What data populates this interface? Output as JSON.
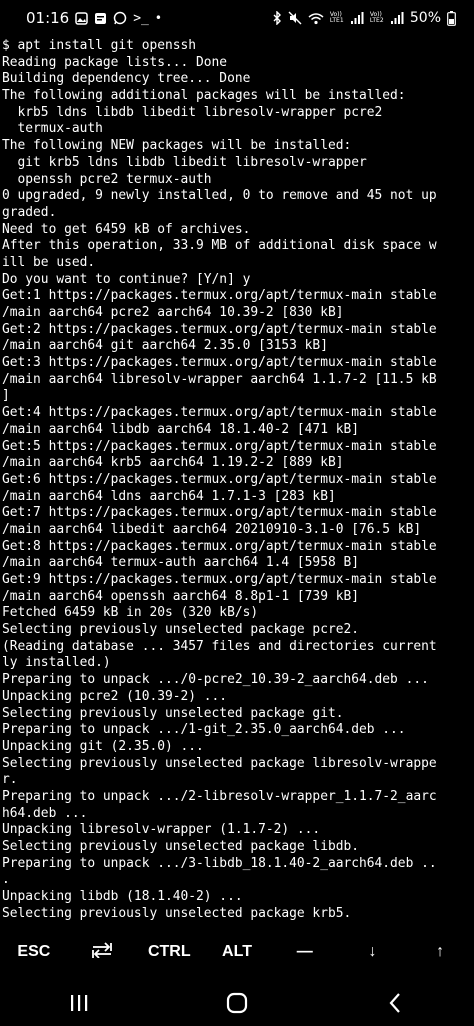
{
  "status_bar": {
    "time": "01:16",
    "dot": "•",
    "network_label": "Vo)) LTE1",
    "network_label2": "Vo)) LTE2",
    "battery": "50%",
    "icons": [
      "gallery-icon",
      "notification-icon",
      "whatsapp-icon",
      "terminal-icon",
      "bluetooth-icon",
      "mute-icon",
      "wifi-icon",
      "signal-icon",
      "battery-icon"
    ]
  },
  "terminal": {
    "lines": [
      "$ apt install git openssh",
      "Reading package lists... Done",
      "Building dependency tree... Done",
      "The following additional packages will be installed:",
      "  krb5 ldns libdb libedit libresolv-wrapper pcre2",
      "  termux-auth",
      "The following NEW packages will be installed:",
      "  git krb5 ldns libdb libedit libresolv-wrapper",
      "  openssh pcre2 termux-auth",
      "0 upgraded, 9 newly installed, 0 to remove and 45 not up",
      "graded.",
      "Need to get 6459 kB of archives.",
      "After this operation, 33.9 MB of additional disk space w",
      "ill be used.",
      "Do you want to continue? [Y/n] y",
      "Get:1 https://packages.termux.org/apt/termux-main stable",
      "/main aarch64 pcre2 aarch64 10.39-2 [830 kB]",
      "Get:2 https://packages.termux.org/apt/termux-main stable",
      "/main aarch64 git aarch64 2.35.0 [3153 kB]",
      "Get:3 https://packages.termux.org/apt/termux-main stable",
      "/main aarch64 libresolv-wrapper aarch64 1.1.7-2 [11.5 kB",
      "]",
      "Get:4 https://packages.termux.org/apt/termux-main stable",
      "/main aarch64 libdb aarch64 18.1.40-2 [471 kB]",
      "Get:5 https://packages.termux.org/apt/termux-main stable",
      "/main aarch64 krb5 aarch64 1.19.2-2 [889 kB]",
      "Get:6 https://packages.termux.org/apt/termux-main stable",
      "/main aarch64 ldns aarch64 1.7.1-3 [283 kB]",
      "Get:7 https://packages.termux.org/apt/termux-main stable",
      "/main aarch64 libedit aarch64 20210910-3.1-0 [76.5 kB]",
      "Get:8 https://packages.termux.org/apt/termux-main stable",
      "/main aarch64 termux-auth aarch64 1.4 [5958 B]",
      "Get:9 https://packages.termux.org/apt/termux-main stable",
      "/main aarch64 openssh aarch64 8.8p1-1 [739 kB]",
      "Fetched 6459 kB in 20s (320 kB/s)",
      "Selecting previously unselected package pcre2.",
      "(Reading database ... 3457 files and directories current",
      "ly installed.)",
      "Preparing to unpack .../0-pcre2_10.39-2_aarch64.deb ...",
      "Unpacking pcre2 (10.39-2) ...",
      "Selecting previously unselected package git.",
      "Preparing to unpack .../1-git_2.35.0_aarch64.deb ...",
      "Unpacking git (2.35.0) ...",
      "Selecting previously unselected package libresolv-wrappe",
      "r.",
      "Preparing to unpack .../2-libresolv-wrapper_1.1.7-2_aarc",
      "h64.deb ...",
      "Unpacking libresolv-wrapper (1.1.7-2) ...",
      "Selecting previously unselected package libdb.",
      "Preparing to unpack .../3-libdb_18.1.40-2_aarch64.deb ..",
      ".",
      "Unpacking libdb (18.1.40-2) ...",
      "Selecting previously unselected package krb5."
    ]
  },
  "extra_keys": {
    "esc": "ESC",
    "tab": "⇄",
    "ctrl": "CTRL",
    "alt": "ALT",
    "dash": "—",
    "down": "↓",
    "up": "↑"
  }
}
